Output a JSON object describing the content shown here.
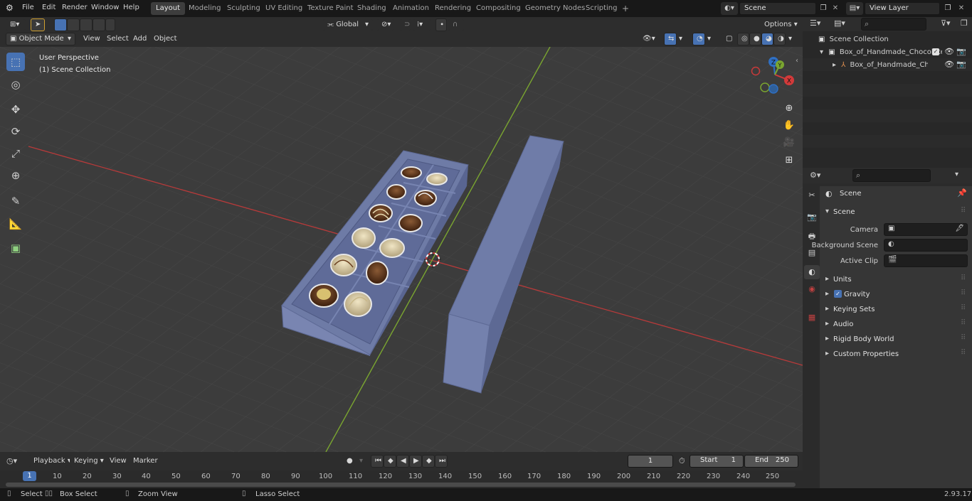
{
  "menubar": {
    "items": [
      "File",
      "Edit",
      "Render",
      "Window",
      "Help"
    ],
    "workspaces": [
      "Layout",
      "Modeling",
      "Sculpting",
      "UV Editing",
      "Texture Paint",
      "Shading",
      "Animation",
      "Rendering",
      "Compositing",
      "Geometry Nodes",
      "Scripting"
    ],
    "active_workspace": "Layout",
    "add_workspace": "+",
    "scene_name": "Scene",
    "view_layer": "View Layer"
  },
  "viewport_header": {
    "mode": "Object Mode",
    "menus": [
      "View",
      "Select",
      "Add",
      "Object"
    ],
    "orientation": "Global",
    "options": "Options"
  },
  "viewport": {
    "perspective": "User Perspective",
    "collection": "(1) Scene Collection",
    "gizmo": {
      "x": "X",
      "y": "Y",
      "z": "Z"
    },
    "colors": {
      "x_axis": "#b83a3a",
      "y_axis": "#7aa530",
      "box": "#6c79a5",
      "bg": "#3c3c3c",
      "grid": "#474747"
    }
  },
  "toolbar": {
    "tools": [
      "select-box",
      "cursor",
      "move",
      "rotate",
      "scale",
      "transform",
      "annotate",
      "measure",
      "add-cube"
    ]
  },
  "outliner": {
    "search_placeholder": "",
    "items": [
      {
        "label": "Scene Collection",
        "indent": 0
      },
      {
        "label": "Box_of_Handmade_Chocolate",
        "indent": 1
      },
      {
        "label": "Box_of_Handmade_Chocolate",
        "indent": 2
      }
    ]
  },
  "properties": {
    "header": "Scene",
    "section": "Scene",
    "fields": [
      {
        "label": "Camera",
        "value": ""
      },
      {
        "label": "Background Scene",
        "value": ""
      },
      {
        "label": "Active Clip",
        "value": ""
      }
    ],
    "panels": [
      {
        "label": "Units",
        "checkbox": false
      },
      {
        "label": "Gravity",
        "checkbox": true
      },
      {
        "label": "Keying Sets",
        "checkbox": false
      },
      {
        "label": "Audio",
        "checkbox": false
      },
      {
        "label": "Rigid Body World",
        "checkbox": false
      },
      {
        "label": "Custom Properties",
        "checkbox": false
      }
    ]
  },
  "timeline": {
    "menus": [
      "Playback",
      "Keying",
      "View",
      "Marker"
    ],
    "current_frame": "1",
    "start_label": "Start",
    "start": "1",
    "end_label": "End",
    "end": "250",
    "ticks": [
      "1",
      "10",
      "20",
      "30",
      "40",
      "50",
      "60",
      "70",
      "80",
      "90",
      "100",
      "110",
      "120",
      "130",
      "140",
      "150",
      "160",
      "170",
      "180",
      "190",
      "200",
      "210",
      "220",
      "230",
      "240",
      "250"
    ]
  },
  "statusbar": {
    "select": "Select",
    "box_select": "Box Select",
    "zoom_view": "Zoom View",
    "lasso_select": "Lasso Select",
    "version": "2.93.17"
  }
}
